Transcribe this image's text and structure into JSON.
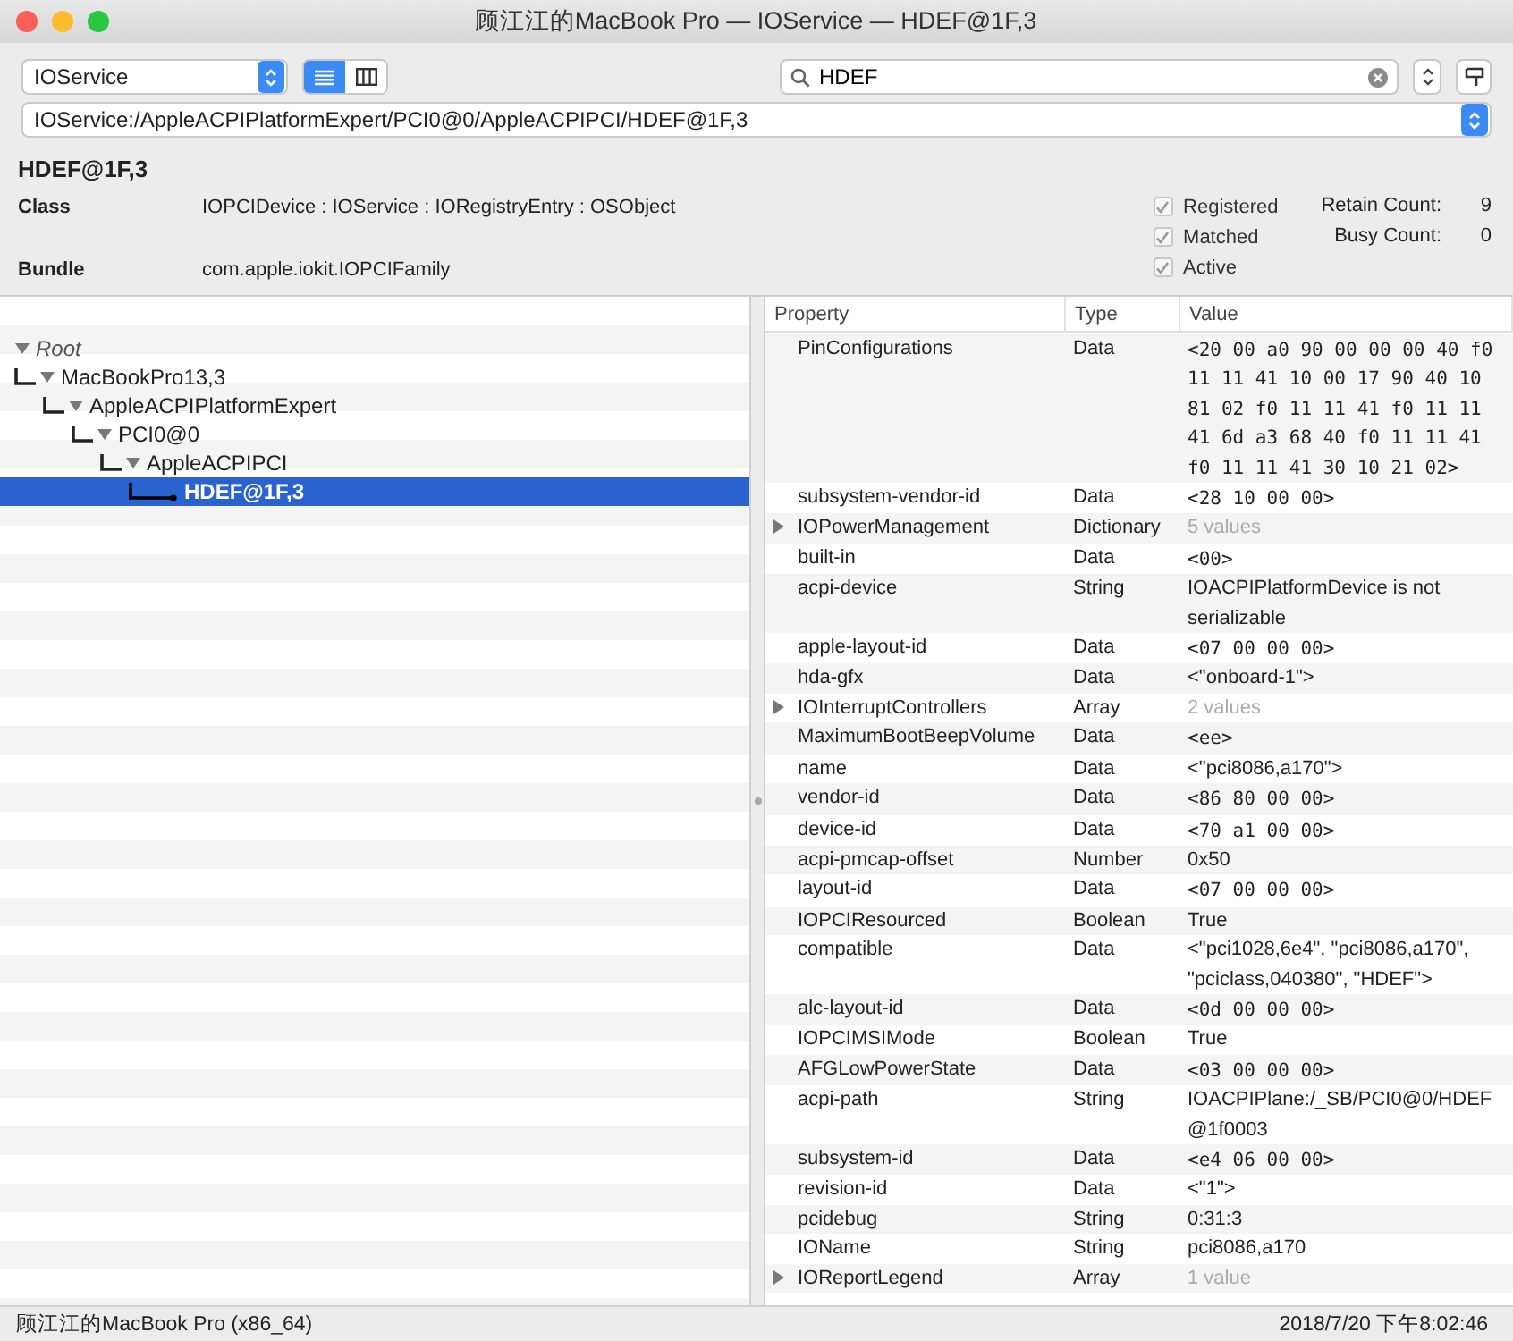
{
  "window": {
    "title": "顾江江的MacBook Pro — IOService — HDEF@1F,3"
  },
  "toolbar": {
    "plane": "IOService",
    "views": [
      {
        "kind": "list",
        "selected": true
      },
      {
        "kind": "columns",
        "selected": false
      }
    ],
    "search": {
      "value": "HDEF"
    },
    "path": "IOService:/AppleACPIPlatformExpert/PCI0@0/AppleACPIPCI/HDEF@1F,3"
  },
  "header": {
    "name": "HDEF@1F,3",
    "fields": [
      {
        "label": "Class",
        "value": "IOPCIDevice : IOService : IORegistryEntry : OSObject"
      },
      {
        "label": "Bundle",
        "value": "com.apple.iokit.IOPCIFamily"
      }
    ],
    "flags": [
      {
        "label": "Registered",
        "checked": true
      },
      {
        "label": "Matched",
        "checked": true
      },
      {
        "label": "Active",
        "checked": true
      }
    ],
    "counts": [
      {
        "label": "Retain Count:",
        "value": "9"
      },
      {
        "label": "Busy Count:",
        "value": "0"
      }
    ]
  },
  "tree": [
    {
      "label": "Root",
      "expanded": true,
      "selected": false,
      "children": [
        {
          "label": "MacBookPro13,3",
          "expanded": true,
          "selected": false,
          "children": [
            {
              "label": "AppleACPIPlatformExpert",
              "expanded": true,
              "selected": false,
              "children": [
                {
                  "label": "PCI0@0",
                  "expanded": true,
                  "selected": false,
                  "children": [
                    {
                      "label": "AppleACPIPCI",
                      "expanded": true,
                      "selected": false,
                      "children": [
                        {
                          "label": "HDEF@1F,3",
                          "expanded": false,
                          "selected": true
                        }
                      ]
                    }
                  ]
                }
              ]
            }
          ]
        }
      ]
    }
  ],
  "properties": {
    "columns": [
      "Property",
      "Type",
      "Value"
    ],
    "rows": [
      {
        "name": "PinConfigurations",
        "type": "Data",
        "value": "<20 00 a0 90 00 00 00 40 f0 11 11 41 10 00 17 90 40 10 81 02 f0 11 11 41 f0 11 11 41 6d a3 68 40 f0 11 11 41 f0 11 11 41 30 10 21 02>",
        "kind": "data"
      },
      {
        "name": "subsystem-vendor-id",
        "type": "Data",
        "value": "<28 10 00 00>",
        "kind": "data"
      },
      {
        "name": "IOPowerManagement",
        "type": "Dictionary",
        "value": "5 values",
        "kind": "summary"
      },
      {
        "name": "built-in",
        "type": "Data",
        "value": "<00>",
        "kind": "data"
      },
      {
        "name": "acpi-device",
        "type": "String",
        "value": "IOACPIPlatformDevice is not serializable",
        "kind": "text"
      },
      {
        "name": "apple-layout-id",
        "type": "Data",
        "value": "<07 00 00 00>",
        "kind": "data"
      },
      {
        "name": "hda-gfx",
        "type": "Data",
        "value": "<\"onboard-1\">",
        "kind": "text"
      },
      {
        "name": "IOInterruptControllers",
        "type": "Array",
        "value": "2 values",
        "kind": "summary"
      },
      {
        "name": "MaximumBootBeepVolume",
        "type": "Data",
        "value": "<ee>",
        "kind": "data"
      },
      {
        "name": "name",
        "type": "Data",
        "value": "<\"pci8086,a170\">",
        "kind": "text"
      },
      {
        "name": "vendor-id",
        "type": "Data",
        "value": "<86 80 00 00>",
        "kind": "data"
      },
      {
        "name": "device-id",
        "type": "Data",
        "value": "<70 a1 00 00>",
        "kind": "data"
      },
      {
        "name": "acpi-pmcap-offset",
        "type": "Number",
        "value": "0x50",
        "kind": "text"
      },
      {
        "name": "layout-id",
        "type": "Data",
        "value": "<07 00 00 00>",
        "kind": "data"
      },
      {
        "name": "IOPCIResourced",
        "type": "Boolean",
        "value": "True",
        "kind": "text"
      },
      {
        "name": "compatible",
        "type": "Data",
        "value": "<\"pci1028,6e4\", \"pci8086,a170\", \"pciclass,040380\", \"HDEF\">",
        "kind": "text"
      },
      {
        "name": "alc-layout-id",
        "type": "Data",
        "value": "<0d 00 00 00>",
        "kind": "data"
      },
      {
        "name": "IOPCIMSIMode",
        "type": "Boolean",
        "value": "True",
        "kind": "text"
      },
      {
        "name": "AFGLowPowerState",
        "type": "Data",
        "value": "<03 00 00 00>",
        "kind": "data"
      },
      {
        "name": "acpi-path",
        "type": "String",
        "value": "IOACPIPlane:/_SB/PCI0@0/HDEF@1f0003",
        "kind": "text"
      },
      {
        "name": "subsystem-id",
        "type": "Data",
        "value": "<e4 06 00 00>",
        "kind": "data"
      },
      {
        "name": "revision-id",
        "type": "Data",
        "value": "<\"1\">",
        "kind": "text"
      },
      {
        "name": "pcidebug",
        "type": "String",
        "value": "0:31:3",
        "kind": "text"
      },
      {
        "name": "IOName",
        "type": "String",
        "value": "pci8086,a170",
        "kind": "text"
      },
      {
        "name": "IOReportLegend",
        "type": "Array",
        "value": "1 value",
        "kind": "summary"
      }
    ]
  },
  "status_bar": {
    "machine": "顾江江的MacBook Pro (x86_64)",
    "time": "2018/7/20 下午8:02:46"
  }
}
